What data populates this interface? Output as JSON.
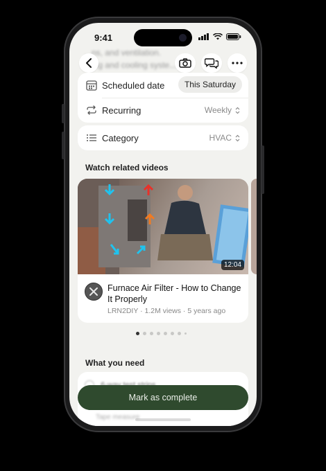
{
  "status_bar": {
    "time": "9:41"
  },
  "background_text": [
    "...ns, and ventilation.",
    "ating and cooling syste..."
  ],
  "top_actions": {
    "back_icon": "chevron-left-icon",
    "camera_icon": "camera-icon",
    "chat_icon": "chat-bubbles-icon",
    "more_icon": "more-dots-icon"
  },
  "schedule": {
    "date_label": "Scheduled date",
    "date_value": "This Saturday",
    "recurring_label": "Recurring",
    "recurring_value": "Weekly"
  },
  "category": {
    "label": "Category",
    "value": "HVAC"
  },
  "videos": {
    "section_title": "Watch related videos",
    "items": [
      {
        "title": "Furnace Air Filter - How to Change It Properly",
        "channel": "LRN2DIY",
        "meta": "LRN2DIY · 1.2M views · 5 years ago",
        "duration": "12:04"
      }
    ],
    "page_count": 8,
    "active_page": 1
  },
  "need": {
    "section_title": "What you need",
    "items": [
      "6-way test strips",
      "Tape measure"
    ]
  },
  "cta": {
    "label": "Mark as complete"
  },
  "colors": {
    "cta_bg": "#2f4a2e",
    "screen_bg": "#f2f2ef"
  }
}
